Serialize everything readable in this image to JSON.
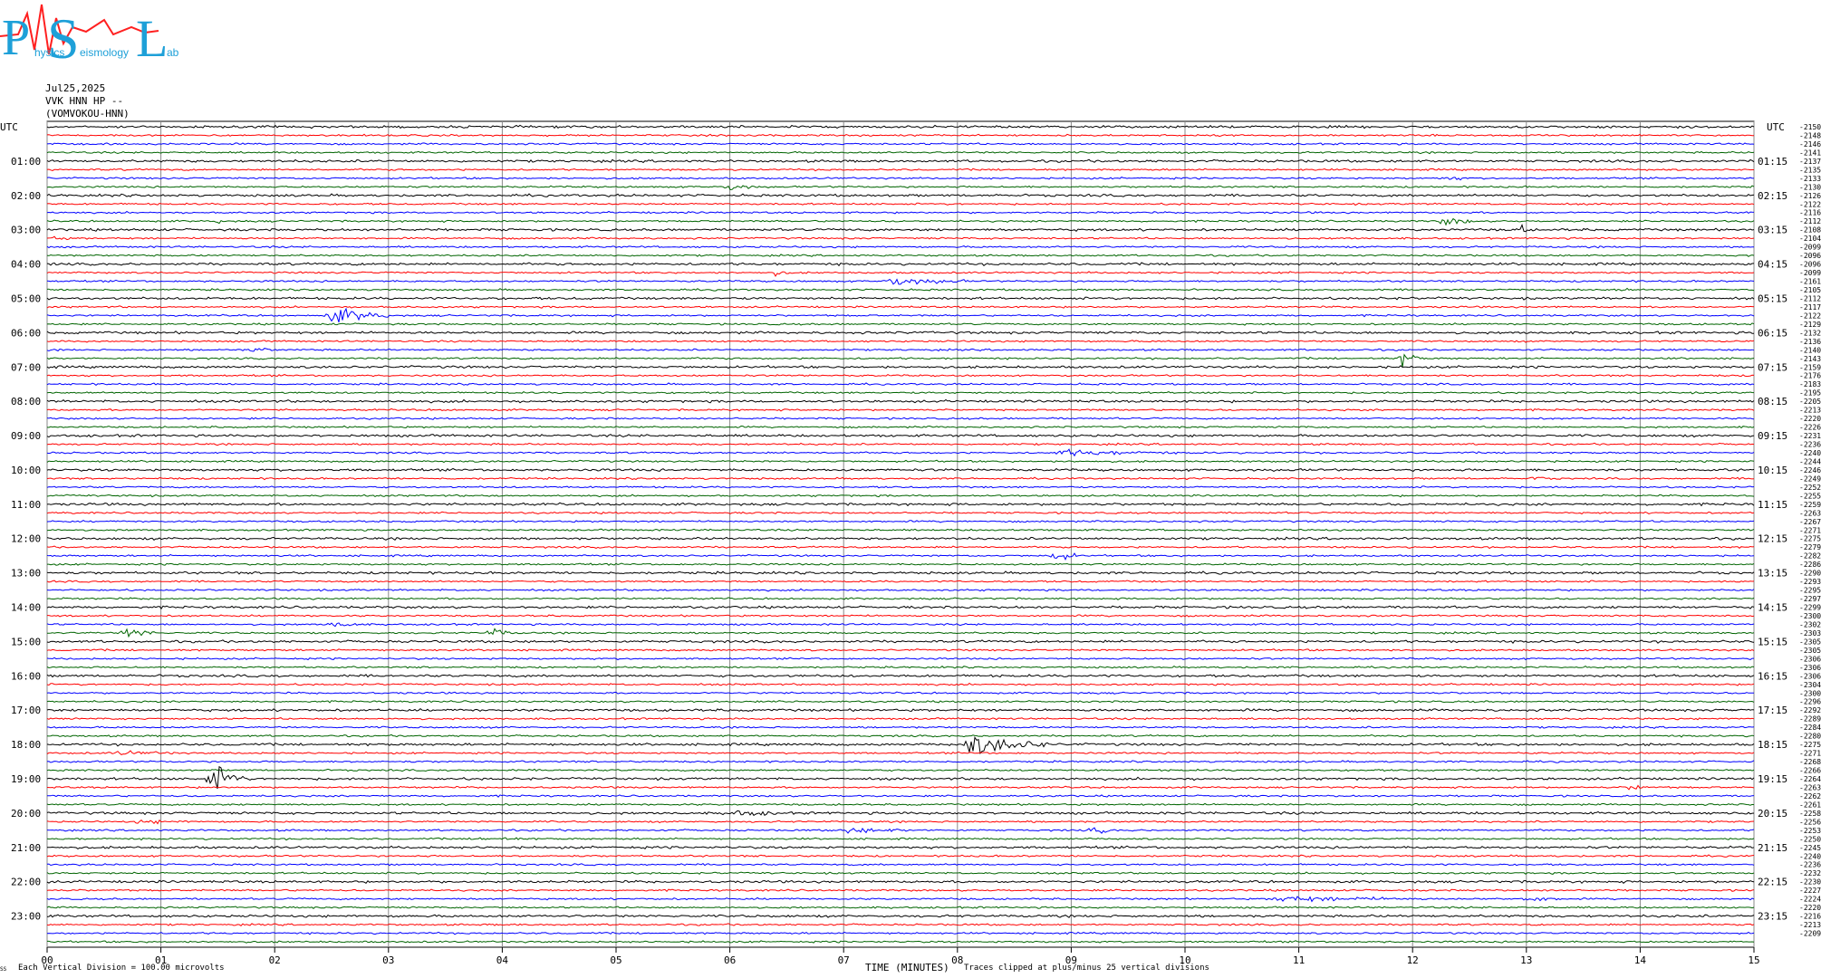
{
  "logo": {
    "letters": [
      "P",
      "S",
      "L"
    ],
    "subtext": [
      "hysics",
      "eismology",
      "ab"
    ]
  },
  "header": {
    "date": "Jul25,2025",
    "station": "VVK HNN HP --",
    "location": "(VOMVOKOU-HNN)"
  },
  "colors": {
    "black": "#000000",
    "red": "#ff0000",
    "blue": "#0000ff",
    "green": "#006400",
    "grid": "#888888"
  },
  "chart_data": {
    "type": "line",
    "title": "",
    "xlabel": "TIME (MINUTES)",
    "ylabel": "",
    "xlim": [
      0,
      15
    ],
    "x_ticks": [
      "00",
      "01",
      "02",
      "03",
      "04",
      "05",
      "06",
      "07",
      "08",
      "09",
      "10",
      "11",
      "12",
      "13",
      "14",
      "15"
    ],
    "left_axis_title": "UTC",
    "right_axis_title": "UTC",
    "left_time_labels": [
      "01:00",
      "02:00",
      "03:00",
      "04:00",
      "05:00",
      "06:00",
      "07:00",
      "08:00",
      "09:00",
      "10:00",
      "11:00",
      "12:00",
      "13:00",
      "14:00",
      "15:00",
      "16:00",
      "17:00",
      "18:00",
      "19:00",
      "20:00",
      "21:00",
      "22:00",
      "23:00"
    ],
    "right_time_labels": [
      "01:15",
      "02:15",
      "03:15",
      "04:15",
      "05:15",
      "06:15",
      "07:15",
      "08:15",
      "09:15",
      "10:15",
      "11:15",
      "12:15",
      "13:15",
      "14:15",
      "15:15",
      "16:15",
      "17:15",
      "18:15",
      "19:15",
      "20:15",
      "21:15",
      "22:15",
      "23:15"
    ],
    "trace_count": 96,
    "trace_color_cycle": [
      "black",
      "red",
      "blue",
      "green"
    ],
    "trace_offsets": [
      "-21508",
      "-21487",
      "-21461",
      "-21416",
      "-21378",
      "-21355",
      "-21330",
      "-21301",
      "-21266",
      "-21221",
      "-21165",
      "-21126",
      "-21084",
      "-21046",
      "-20996",
      "-20963",
      "-20962",
      "-20998",
      "-21618",
      "-21057",
      "-21122",
      "-21179",
      "-21226",
      "-21296",
      "-21326",
      "-21361",
      "-21401",
      "-21437",
      "-21591",
      "-21767",
      "-21830",
      "-21955",
      "-22054",
      "-22138",
      "-22205",
      "-22263",
      "-22318",
      "-22368",
      "-22407",
      "-22446",
      "-22464",
      "-22491",
      "-22522",
      "-22554",
      "-22592",
      "-22635",
      "-22676",
      "-22711",
      "-22753",
      "-22790",
      "-22829",
      "-22868",
      "-22901",
      "-22938",
      "-22954",
      "-22977",
      "-22993",
      "-23006",
      "-23021",
      "-23038",
      "-23051",
      "-23059",
      "-23064",
      "-23068",
      "-23067",
      "-23042",
      "-23001",
      "-22962",
      "-22929",
      "-22890",
      "-22840",
      "-22803",
      "-22755",
      "-22712",
      "-22687",
      "-22662",
      "-22642",
      "-22634",
      "-22624",
      "-22610",
      "-22580",
      "-22560",
      "-22535",
      "-22504",
      "-22456",
      "-22407",
      "-22364",
      "-22329",
      "-22300",
      "-22273",
      "-22245",
      "-22205",
      "-22164",
      "-22134",
      "-22095"
    ],
    "events": [
      {
        "trace": 6,
        "minute": 12.3,
        "amp": 3,
        "dur": 0.15
      },
      {
        "trace": 7,
        "minute": 6.0,
        "amp": 3,
        "dur": 0.25
      },
      {
        "trace": 11,
        "minute": 1.5,
        "amp": 3,
        "dur": 0.05
      },
      {
        "trace": 11,
        "minute": 12.25,
        "amp": 5,
        "dur": 0.3
      },
      {
        "trace": 12,
        "minute": 12.95,
        "amp": 7,
        "dur": 0.05
      },
      {
        "trace": 13,
        "minute": 0.1,
        "amp": 4,
        "dur": 0.08
      },
      {
        "trace": 17,
        "minute": 6.4,
        "amp": 2,
        "dur": 0.15
      },
      {
        "trace": 18,
        "minute": 7.4,
        "amp": 4,
        "dur": 0.7
      },
      {
        "trace": 19,
        "minute": 13.8,
        "amp": 3,
        "dur": 0.1
      },
      {
        "trace": 22,
        "minute": 2.5,
        "amp": 9,
        "dur": 0.5
      },
      {
        "trace": 26,
        "minute": 1.8,
        "amp": 3,
        "dur": 0.2
      },
      {
        "trace": 27,
        "minute": 11.9,
        "amp": 8,
        "dur": 0.2
      },
      {
        "trace": 38,
        "minute": 8.9,
        "amp": 3,
        "dur": 1.0
      },
      {
        "trace": 41,
        "minute": 13.1,
        "amp": 4,
        "dur": 0.08
      },
      {
        "trace": 50,
        "minute": 8.85,
        "amp": 7,
        "dur": 0.2
      },
      {
        "trace": 59,
        "minute": 0.7,
        "amp": 6,
        "dur": 0.25
      },
      {
        "trace": 59,
        "minute": 3.9,
        "amp": 5,
        "dur": 0.2
      },
      {
        "trace": 58,
        "minute": 2.5,
        "amp": 3,
        "dur": 0.3
      },
      {
        "trace": 72,
        "minute": 8.1,
        "amp": 12,
        "dur": 0.7
      },
      {
        "trace": 73,
        "minute": 0.6,
        "amp": 2,
        "dur": 0.6
      },
      {
        "trace": 76,
        "minute": 1.45,
        "amp": 16,
        "dur": 0.3
      },
      {
        "trace": 77,
        "minute": 13.95,
        "amp": 5,
        "dur": 0.12
      },
      {
        "trace": 80,
        "minute": 6.0,
        "amp": 3,
        "dur": 0.5
      },
      {
        "trace": 81,
        "minute": 0.8,
        "amp": 2,
        "dur": 0.5
      },
      {
        "trace": 82,
        "minute": 7.0,
        "amp": 3,
        "dur": 0.6
      },
      {
        "trace": 82,
        "minute": 9.2,
        "amp": 3,
        "dur": 0.2
      },
      {
        "trace": 83,
        "minute": 3.8,
        "amp": 2,
        "dur": 0.4
      },
      {
        "trace": 90,
        "minute": 10.8,
        "amp": 3,
        "dur": 1.3
      },
      {
        "trace": 90,
        "minute": 13.0,
        "amp": 3,
        "dur": 0.3
      }
    ],
    "footer_left": "Each Vertical Division =  100.00 microvolts",
    "footer_mid": "Traces clipped at plus/minus 25 vertical divisions",
    "corner_mark": "SS"
  }
}
